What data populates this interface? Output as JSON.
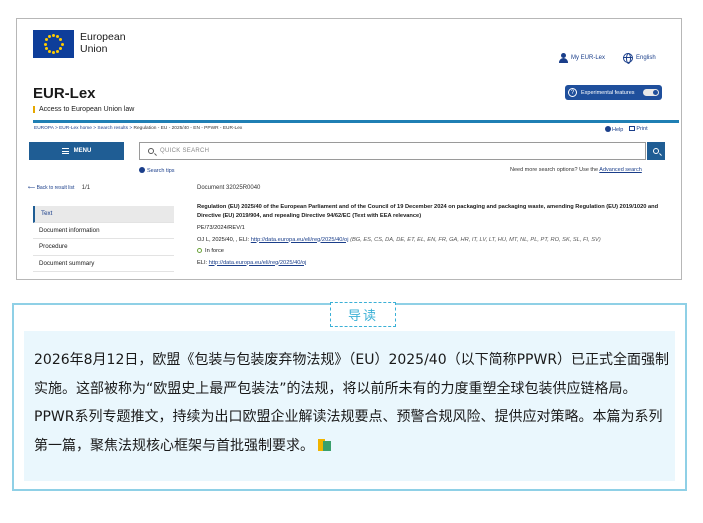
{
  "header": {
    "eu_name_line1": "European",
    "eu_name_line2": "Union",
    "my_eurlex": "My EUR-Lex",
    "language": "English",
    "site_title": "EUR-Lex",
    "site_subtitle": "Access to European Union law",
    "experimental": "Experimental features"
  },
  "breadcrumb": {
    "items": [
      "EUROPA",
      "EUR-Lex home",
      "Search results"
    ],
    "current": "Regulation - EU - 2025/40 - EN - PPWR - EUR-Lex"
  },
  "tools": {
    "help": "Help",
    "print": "Print"
  },
  "search": {
    "menu_label": "MENU",
    "placeholder": "QUICK SEARCH",
    "tips": "Search tips",
    "more_options": "Need more search options? Use the",
    "advanced": "Advanced search"
  },
  "nav": {
    "back": "Back to result list",
    "page": "1/1",
    "document_id": "Document 32025R0040"
  },
  "sidebar": {
    "items": [
      "Text",
      "Document information",
      "Procedure",
      "Document summary"
    ],
    "active": "Text"
  },
  "document": {
    "title": "Regulation (EU) 2025/40 of the European Parliament and of the Council of 19 December 2024 on packaging and packaging waste, amending Regulation (EU) 2019/1020 and Directive (EU) 2019/904, and repealing Directive 94/62/EC (Text with EEA relevance)",
    "reference": "PE/73/2024/REV/1",
    "oj_prefix": "OJ L, 2025/40, , ELI:",
    "oj_link": "http://data.europa.eu/eli/reg/2025/40/oj",
    "languages": "(BG, ES, CS, DA, DE, ET, EL, EN, FR, GA, HR, IT, LV, LT, HU, MT, NL, PL, PT, RO, SK, SL, FI, SV)",
    "status": "In force",
    "eli_prefix": "ELI:",
    "eli_link": "http://data.europa.eu/eli/reg/2025/40/oj"
  },
  "lead": {
    "label": "导读",
    "text": "2026年8月12日，欧盟《包装与包装废弃物法规》（EU）2025/40（以下简称PPWR）已正式全面强制实施。这部被称为“欧盟史上最严包装法”的法规，将以前所未有的力度重塑全球包装供应链格局。PPWR系列专题推文，持续为出口欧盟企业解读法规要点、预警合规风险、提供应对策略。本篇为系列第一篇，聚焦法规核心框架与首批强制要求。"
  },
  "colors": {
    "eu_blue": "#0e3e9a",
    "eu_gold": "#ffcc00",
    "accent": "#1f5d94",
    "lead_border": "#8fd0e6",
    "lead_bg": "#eaf7fd"
  }
}
